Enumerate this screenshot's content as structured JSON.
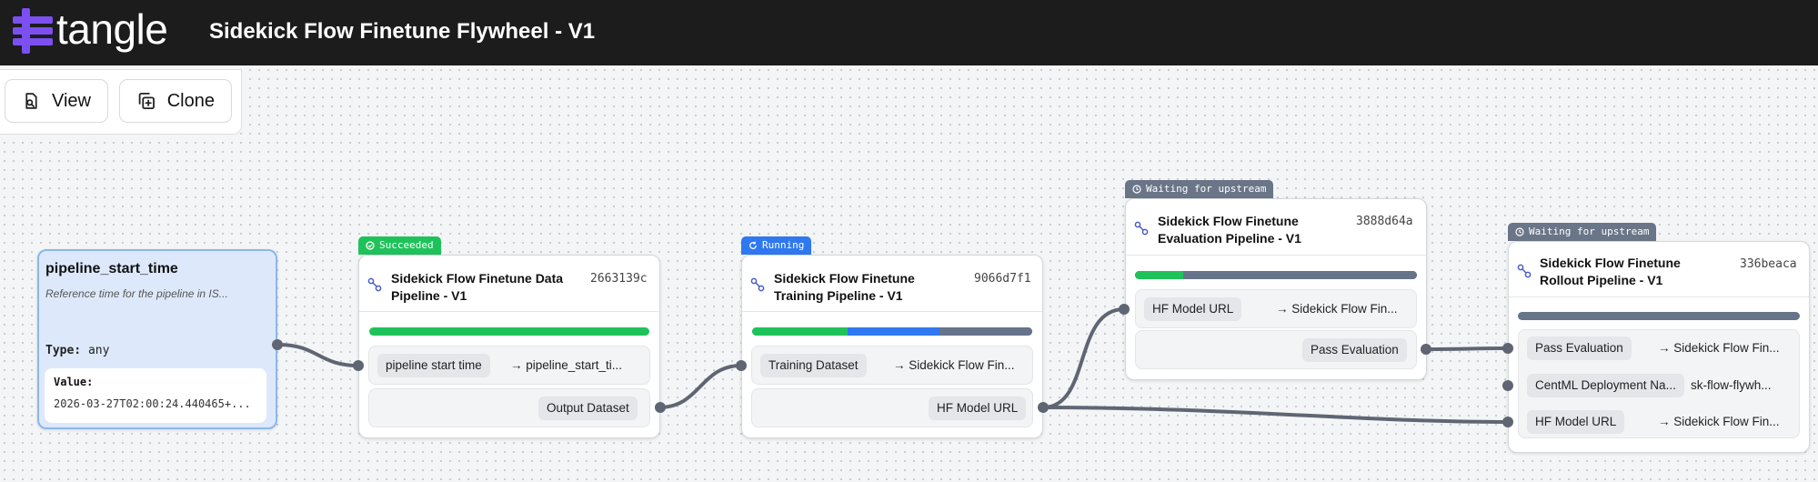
{
  "app": {
    "brand": "tangle",
    "pipeline_title": "Sidekick Flow Finetune Flywheel - V1"
  },
  "colors": {
    "header_bg": "#1c1c1c",
    "logo_purple": "#7b4ff0",
    "succeeded": "#1fc25a",
    "running": "#2f78f0",
    "waiting": "#6a7588",
    "edge": "#5f6573",
    "input_node_bg": "#dde9fb"
  },
  "toolbar": {
    "view_label": "View",
    "clone_label": "Clone"
  },
  "input_node": {
    "name": "pipeline_start_time",
    "description": "Reference time for the pipeline in IS...",
    "type_label": "Type:",
    "type_value": "any",
    "value_label": "Value:",
    "value": "2026-03-27T02:00:24.440465+..."
  },
  "nodes": [
    {
      "status": "Succeeded",
      "title_line1": "Sidekick Flow Finetune Data",
      "title_line2": "Pipeline - V1",
      "hash": "2663139c",
      "progress": {
        "succeeded": 1.0,
        "running": 0.0,
        "waiting": 0.0
      },
      "inputs": [
        {
          "name": "pipeline start time",
          "value": "→ pipeline_start_ti..."
        }
      ],
      "outputs": [
        {
          "name": "Output Dataset"
        }
      ]
    },
    {
      "status": "Running",
      "title_line1": "Sidekick Flow Finetune",
      "title_line2": "Training Pipeline - V1",
      "hash": "9066d7f1",
      "progress": {
        "succeeded": 0.34,
        "running": 0.33,
        "waiting": 0.33
      },
      "inputs": [
        {
          "name": "Training Dataset",
          "value": "→ Sidekick Flow Fin..."
        }
      ],
      "outputs": [
        {
          "name": "HF Model URL"
        }
      ]
    },
    {
      "status": "Waiting for upstream",
      "title_line1": "Sidekick Flow Finetune",
      "title_line2": "Evaluation Pipeline - V1",
      "hash": "3888d64a",
      "progress": {
        "succeeded": 0.17,
        "running": 0.0,
        "waiting": 0.83
      },
      "inputs": [
        {
          "name": "HF Model URL",
          "value": "→ Sidekick Flow Fin..."
        }
      ],
      "outputs": [
        {
          "name": "Pass Evaluation"
        }
      ]
    },
    {
      "status": "Waiting for upstream",
      "title_line1": "Sidekick Flow Finetune",
      "title_line2": "Rollout Pipeline - V1",
      "hash": "336beaca",
      "progress": {
        "succeeded": 0.0,
        "running": 0.0,
        "waiting": 1.0
      },
      "inputs": [
        {
          "name": "Pass Evaluation",
          "value": "→ Sidekick Flow Fin..."
        },
        {
          "name": "CentML Deployment Na...",
          "value": "sk-flow-flywh..."
        },
        {
          "name": "HF Model URL",
          "value": "→ Sidekick Flow Fin..."
        }
      ],
      "outputs": []
    }
  ]
}
